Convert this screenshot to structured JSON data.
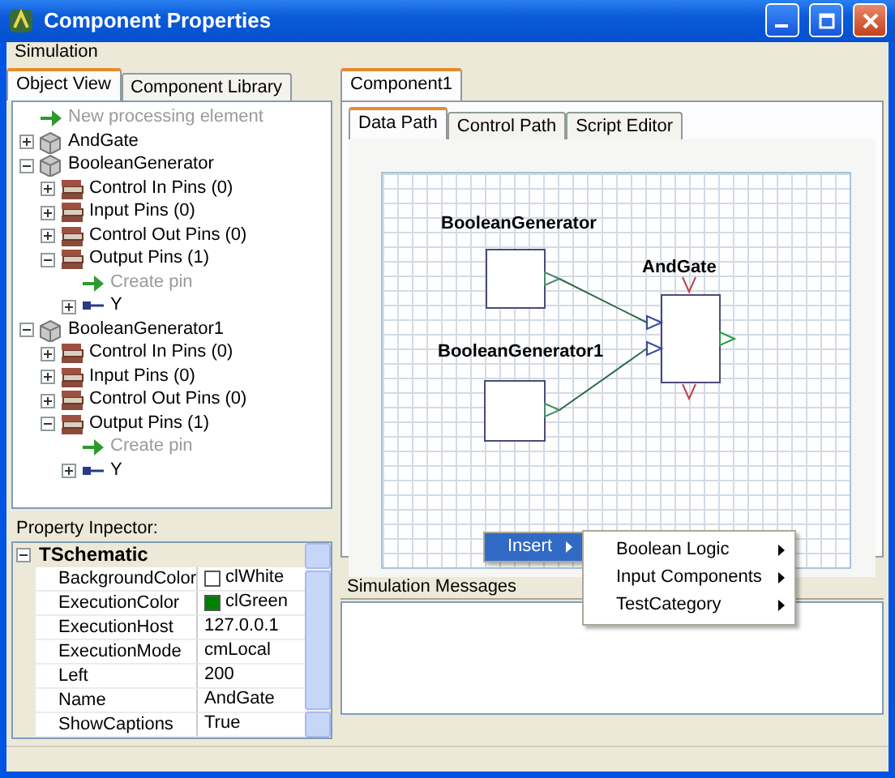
{
  "window": {
    "title": "Component Properties"
  },
  "menu": [
    "Simulation"
  ],
  "left_tabs": [
    {
      "label": "Object View",
      "selected": true
    },
    {
      "label": "Component Library",
      "selected": false
    }
  ],
  "tree": [
    {
      "label": "New processing element",
      "kind": "action"
    },
    {
      "label": "AndGate",
      "kind": "component",
      "expanded": false
    },
    {
      "label": "BooleanGenerator",
      "kind": "component",
      "expanded": true,
      "children": [
        {
          "label": "Control In Pins (0)",
          "kind": "pin_group",
          "expanded": false
        },
        {
          "label": "Input Pins (0)",
          "kind": "pin_group",
          "expanded": false
        },
        {
          "label": "Control Out Pins (0)",
          "kind": "pin_group",
          "expanded": false
        },
        {
          "label": "Output Pins (1)",
          "kind": "pin_group",
          "expanded": true,
          "children": [
            {
              "label": "Create pin",
              "kind": "action"
            },
            {
              "label": "Y",
              "kind": "pin",
              "expanded": false
            }
          ]
        }
      ]
    },
    {
      "label": "BooleanGenerator1",
      "kind": "component",
      "expanded": true,
      "children": [
        {
          "label": "Control In Pins (0)",
          "kind": "pin_group",
          "expanded": false
        },
        {
          "label": "Input Pins (0)",
          "kind": "pin_group",
          "expanded": false
        },
        {
          "label": "Control Out Pins (0)",
          "kind": "pin_group",
          "expanded": false
        },
        {
          "label": "Output Pins (1)",
          "kind": "pin_group",
          "expanded": true,
          "children": [
            {
              "label": "Create pin",
              "kind": "action"
            },
            {
              "label": "Y",
              "kind": "pin",
              "expanded": false
            }
          ]
        }
      ]
    }
  ],
  "property_inspector": {
    "label": "Property Inpector:",
    "section": {
      "title": "TSchematic",
      "expanded": true
    },
    "rows": [
      {
        "name": "BackgroundColor",
        "value": "clWhite",
        "color": "#ffffff"
      },
      {
        "name": "ExecutionColor",
        "value": "clGreen",
        "color": "#008000"
      },
      {
        "name": "ExecutionHost",
        "value": "127.0.0.1"
      },
      {
        "name": "ExecutionMode",
        "value": "cmLocal"
      },
      {
        "name": "Left",
        "value": "200"
      },
      {
        "name": "Name",
        "value": "AndGate"
      },
      {
        "name": "ShowCaptions",
        "value": "True"
      }
    ]
  },
  "document_tabs": [
    {
      "label": "Component1",
      "selected": true
    }
  ],
  "view_tabs": [
    {
      "label": "Data Path",
      "selected": true
    },
    {
      "label": "Control Path",
      "selected": false
    },
    {
      "label": "Script Editor",
      "selected": false
    }
  ],
  "diagram": {
    "nodes": [
      {
        "label": "BooleanGenerator"
      },
      {
        "label": "BooleanGenerator1"
      },
      {
        "label": "AndGate"
      }
    ]
  },
  "context_menu": {
    "items": [
      {
        "label": "Insert",
        "selected": true
      }
    ],
    "submenu": [
      {
        "label": "Boolean Logic"
      },
      {
        "label": "Input Components"
      },
      {
        "label": "TestCategory"
      }
    ]
  },
  "messages": {
    "title": "Simulation Messages"
  }
}
